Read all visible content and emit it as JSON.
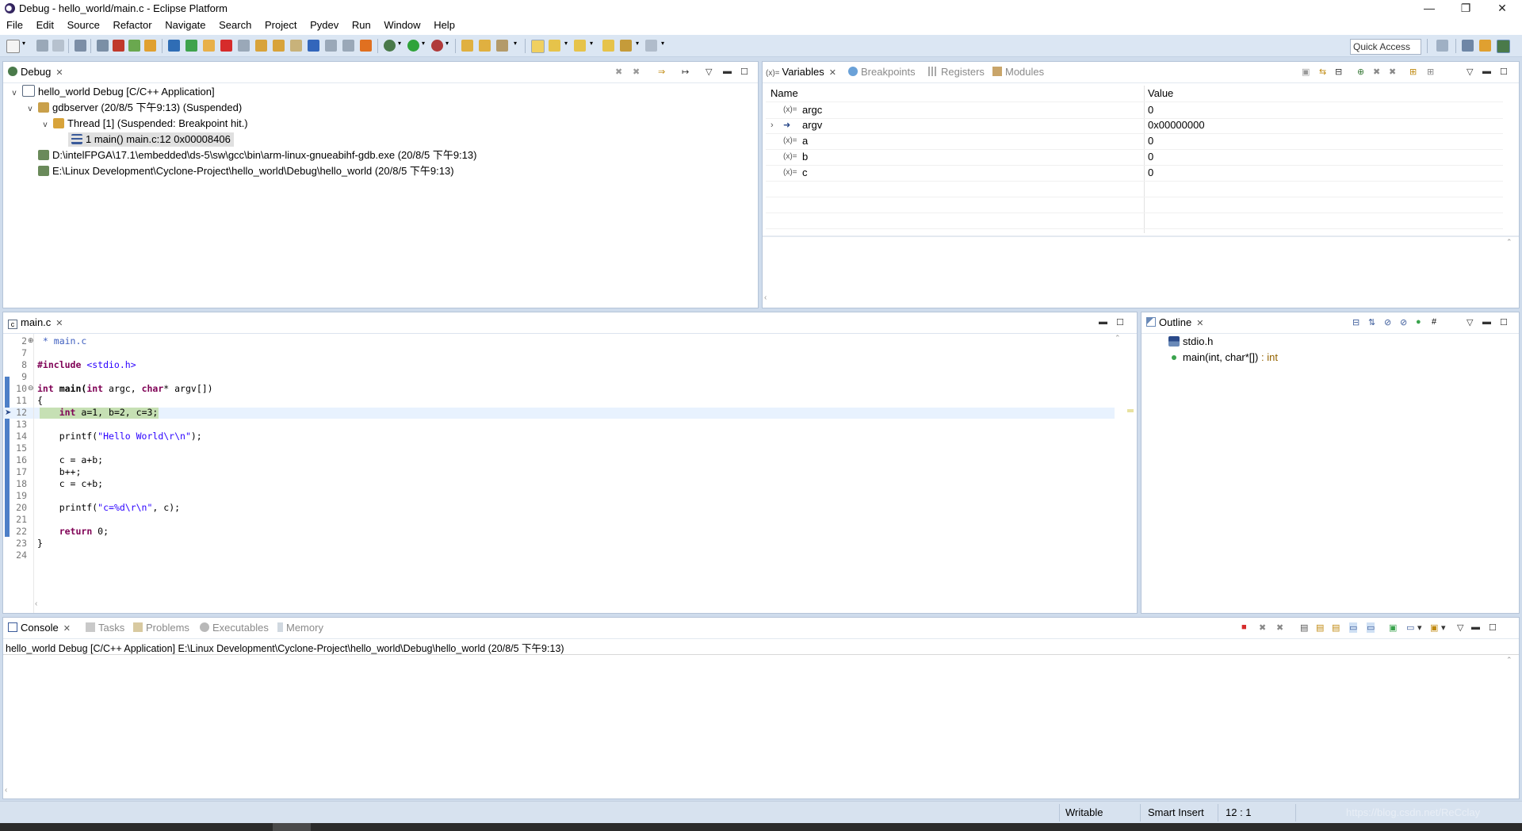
{
  "window": {
    "title": "Debug - hello_world/main.c - Eclipse Platform",
    "controls": [
      "—",
      "❐",
      "✕"
    ]
  },
  "menu": [
    "File",
    "Edit",
    "Source",
    "Refactor",
    "Navigate",
    "Search",
    "Project",
    "Pydev",
    "Run",
    "Window",
    "Help"
  ],
  "toolbar": {
    "quick_access": "Quick Access"
  },
  "debug_view": {
    "tab": "Debug",
    "tree": [
      "hello_world Debug [C/C++ Application]",
      "gdbserver (20/8/5 下午9:13) (Suspended)",
      "Thread [1] (Suspended: Breakpoint hit.)",
      "1 main() main.c:12 0x00008406",
      "D:\\intelFPGA\\17.1\\embedded\\ds-5\\sw\\gcc\\bin\\arm-linux-gnueabihf-gdb.exe (20/8/5 下午9:13)",
      "E:\\Linux Development\\Cyclone-Project\\hello_world\\Debug\\hello_world (20/8/5 下午9:13)"
    ]
  },
  "variables_view": {
    "tabs": [
      "Variables",
      "Breakpoints",
      "Registers",
      "Modules"
    ],
    "columns": [
      "Name",
      "Value"
    ],
    "rows": [
      {
        "name": "argc",
        "value": "0"
      },
      {
        "name": "argv",
        "value": "0x00000000"
      },
      {
        "name": "a",
        "value": "0"
      },
      {
        "name": "b",
        "value": "0"
      },
      {
        "name": "c",
        "value": "0"
      }
    ]
  },
  "editor": {
    "tab": "main.c",
    "line_numbers": [
      "2",
      "7",
      "8",
      "9",
      "10",
      "11",
      "12",
      "13",
      "14",
      "15",
      "16",
      "17",
      "18",
      "19",
      "20",
      "21",
      "22",
      "23",
      "24"
    ],
    "lines": {
      "l2": " * main.c",
      "l8_kw": "#include",
      "l8_inc": " <stdio.h>",
      "l10_kw1": "int",
      "l10_fn": " main(",
      "l10_kw2": "int",
      "l10_mid": " argc, ",
      "l10_kw3": "char",
      "l10_end": "* argv[])",
      "l11": "{",
      "l12_kw": "int",
      "l12_rest": " a=1, b=2, c=3;",
      "l14_fn": "    printf(",
      "l14_str": "\"Hello World\\r\\n\"",
      "l14_end": ");",
      "l16": "    c = a+b;",
      "l17": "    b++;",
      "l18": "    c = c+b;",
      "l20_fn": "    printf(",
      "l20_str": "\"c=%d\\r\\n\"",
      "l20_end": ", c);",
      "l22_kw": "return",
      "l22_rest": " 0;",
      "l23": "}"
    }
  },
  "outline_view": {
    "tab": "Outline",
    "items": [
      {
        "label": "stdio.h",
        "type": ""
      },
      {
        "label": "main(int, char*[])",
        "type": " : int"
      }
    ]
  },
  "console_view": {
    "tabs": [
      "Console",
      "Tasks",
      "Problems",
      "Executables",
      "Memory"
    ],
    "header": "hello_world Debug [C/C++ Application] E:\\Linux Development\\Cyclone-Project\\hello_world\\Debug\\hello_world (20/8/5 下午9:13)"
  },
  "status_bar": {
    "mode": "Writable",
    "insert": "Smart Insert",
    "position": "12 : 1",
    "watermark": "https://blog.csdn.net/ReCclay"
  },
  "colors": {
    "toolbar_bg": "#dbe6f3",
    "current_line": "#e8f2fe",
    "instruction_hl": "#c6e0b4",
    "keyword": "#7f0055",
    "string": "#2a00ff"
  }
}
